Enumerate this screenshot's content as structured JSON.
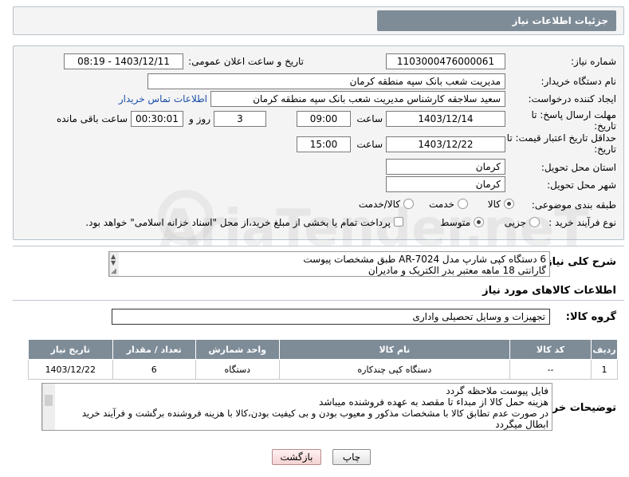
{
  "header": {
    "title": "جزئیات اطلاعات نیاز"
  },
  "fields": {
    "need_number_label": "شماره نیاز:",
    "need_number": "1103000476000061",
    "announce_label": "تاریخ و ساعت اعلان عمومی:",
    "announce_value": "1403/12/11 - 08:19",
    "buyer_org_label": "نام دستگاه خریدار:",
    "buyer_org": "مدیریت شعب بانک سپه منطقه کرمان",
    "creator_label": "ایجاد کننده درخواست:",
    "creator": "سعید سلاجقه کارشناس مدیریت شعب بانک سپه منطقه کرمان",
    "contact_link": "اطلاعات تماس خریدار",
    "deadline_label_1": "مهلت ارسال پاسخ: تا",
    "deadline_label_2": "تاریخ:",
    "deadline_date": "1403/12/14",
    "time_label": "ساعت",
    "deadline_time": "09:00",
    "days": "3",
    "days_label": "روز و",
    "remaining": "00:30:01",
    "remaining_label": "ساعت باقی مانده",
    "validity_label_1": "حداقل تاریخ اعتبار قیمت: تا",
    "validity_label_2": "تاریخ:",
    "validity_date": "1403/12/22",
    "validity_time": "15:00",
    "province_label": "استان محل تحویل:",
    "province": "کرمان",
    "city_label": "شهر محل تحویل:",
    "city": "کرمان",
    "category_label": "طبقه بندی موضوعی:",
    "category_options": [
      "کالا",
      "خدمت",
      "کالا/خدمت"
    ],
    "process_label": "نوع فرآیند خرید :",
    "process_options": [
      "جزیی",
      "متوسط"
    ],
    "payment_note": "پرداخت تمام یا بخشی از مبلغ خرید،از محل \"اسناد خزانه اسلامی\" خواهد بود."
  },
  "summary": {
    "label": "شرح کلی نیاز:",
    "line1": "6 دستگاه کپی شارپ مدل  AR-7024 طبق مشخصات پیوست",
    "line2": "گارانتی 18 ماهه معتبر بدر الکتریک و مادیران"
  },
  "goods": {
    "section_title": "اطلاعات کالاهای مورد نیاز",
    "group_label": "گروه کالا:",
    "group_value": "تجهیزات و وسایل تحصیلی واداری",
    "columns": [
      "ردیف",
      "کد کالا",
      "نام کالا",
      "واحد شمارش",
      "تعداد / مقدار",
      "تاریخ نیاز"
    ],
    "rows": [
      {
        "row": "1",
        "code": "--",
        "name": "دستگاه کپی چندکاره",
        "unit": "دستگاه",
        "qty": "6",
        "date": "1403/12/22"
      }
    ]
  },
  "buyer_notes": {
    "label": "توضیحات خریدار:",
    "lines": [
      "فایل پیوست ملاحظه گردد",
      "هزینه حمل کالا از مبداء تا مقصد به عهده فروشنده میباشد",
      "در صورت عدم تطابق کالا با مشخصات مذکور و معیوب بودن و بی کیفیت بودن،کالا با هزینه فروشنده برگشت و فرآیند خرید",
      "ابطال میگردد"
    ]
  },
  "buttons": {
    "print": "چاپ",
    "back": "بازگشت"
  },
  "watermark": "AriaTender.neT"
}
